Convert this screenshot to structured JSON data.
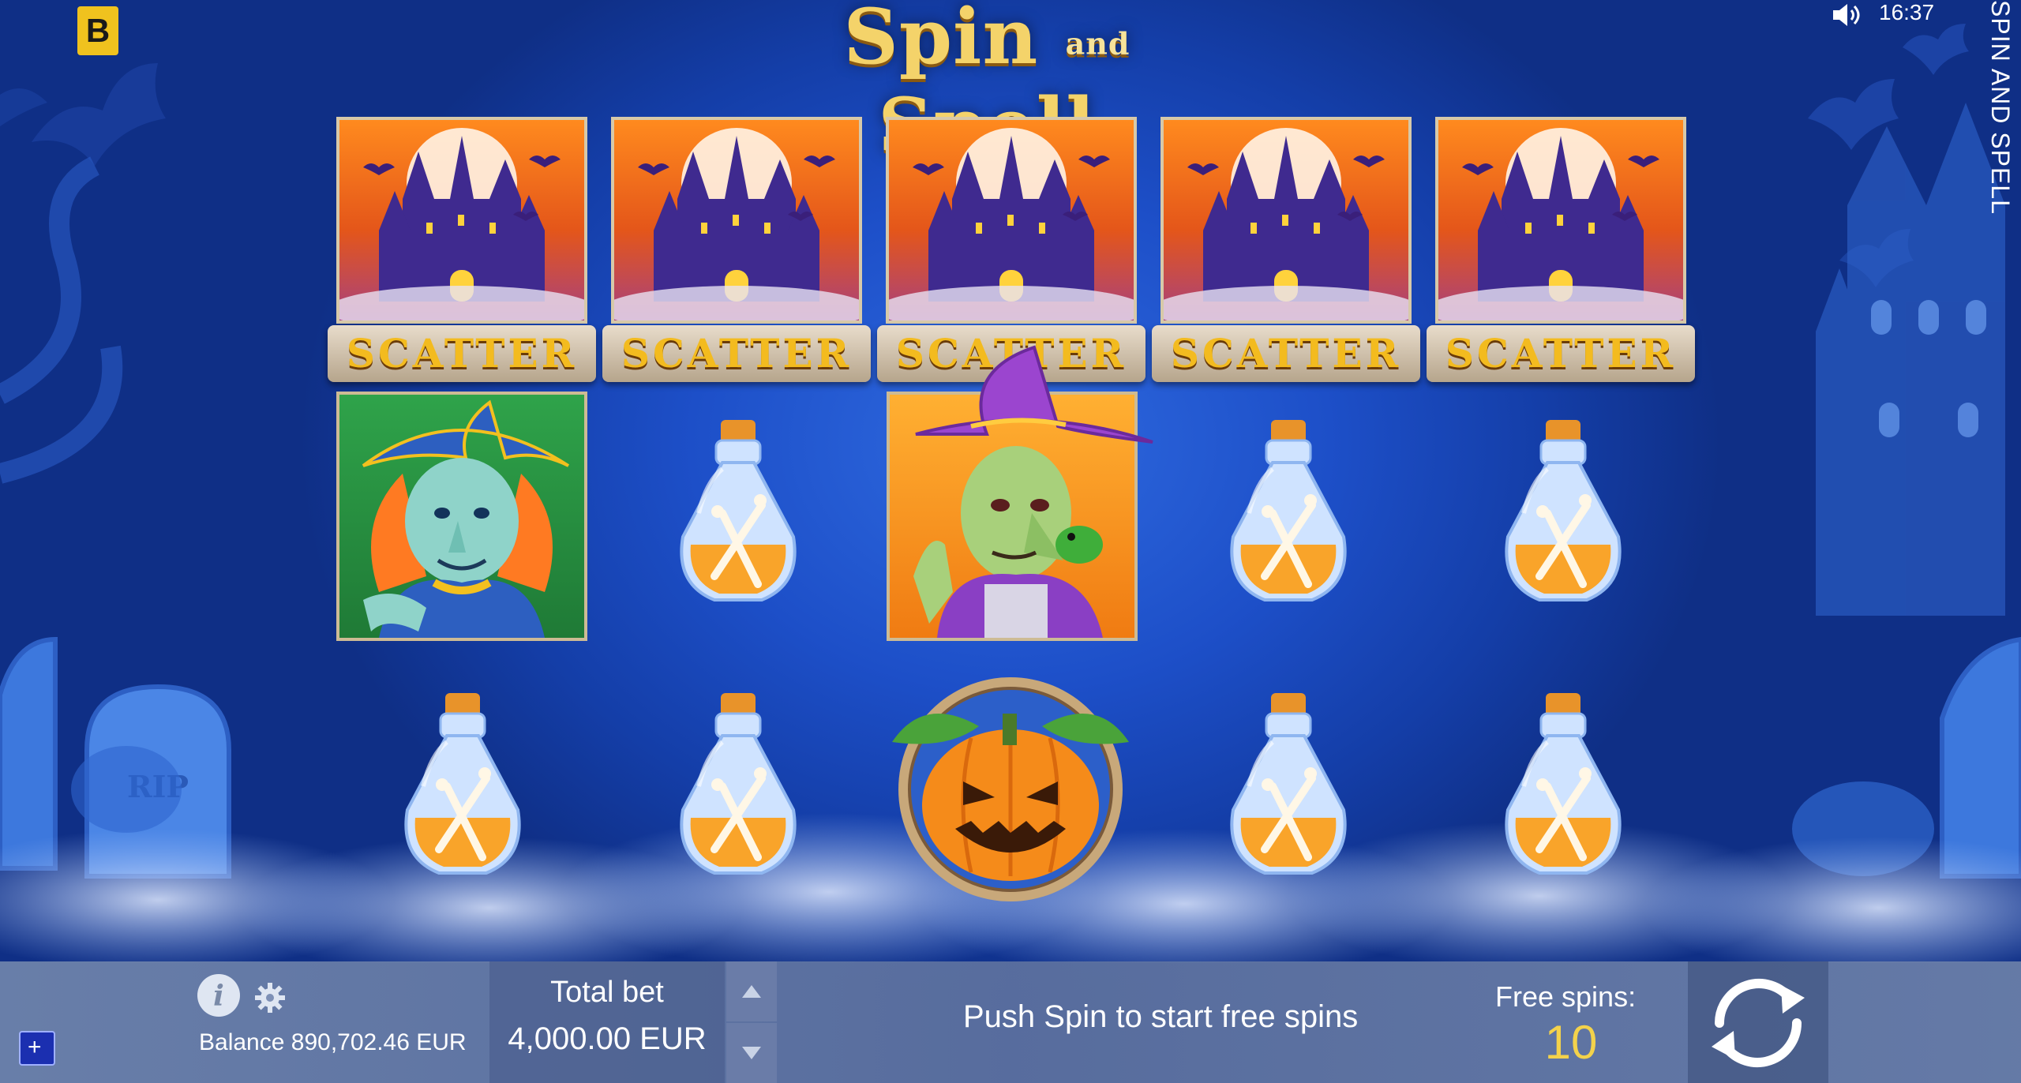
{
  "game": {
    "logo_main_left": "Spin",
    "logo_small": "and",
    "logo_main_right": "Spell",
    "vertical_title": "SPIN AND SPELL",
    "brand_badge": "B",
    "clock": "16:37"
  },
  "reels": {
    "row1": [
      "SCATTER",
      "SCATTER",
      "SCATTER",
      "SCATTER",
      "SCATTER"
    ],
    "row2": [
      "witch-blue",
      "potion",
      "witch-purple",
      "potion",
      "potion"
    ],
    "row3": [
      "potion",
      "potion",
      "pumpkin",
      "potion",
      "potion"
    ],
    "scatter_label": "SCATTER"
  },
  "bottom_bar": {
    "balance_label": "Balance",
    "balance_value": "890,702.46 EUR",
    "total_bet_label": "Total bet",
    "total_bet_value": "4,000.00 EUR",
    "message": "Push Spin to start free spins",
    "free_spins_label": "Free spins:",
    "free_spins_value": "10",
    "plus_button": "+"
  },
  "colors": {
    "background": "#1d4fc8",
    "bar": "#6f82ad",
    "free_spins_value": "#f3d24b",
    "badge": "#f0c21e"
  },
  "icons": [
    "info-icon",
    "gear-icon",
    "sound-icon",
    "arrow-up-icon",
    "arrow-down-icon",
    "spin-icon",
    "plus-icon"
  ]
}
